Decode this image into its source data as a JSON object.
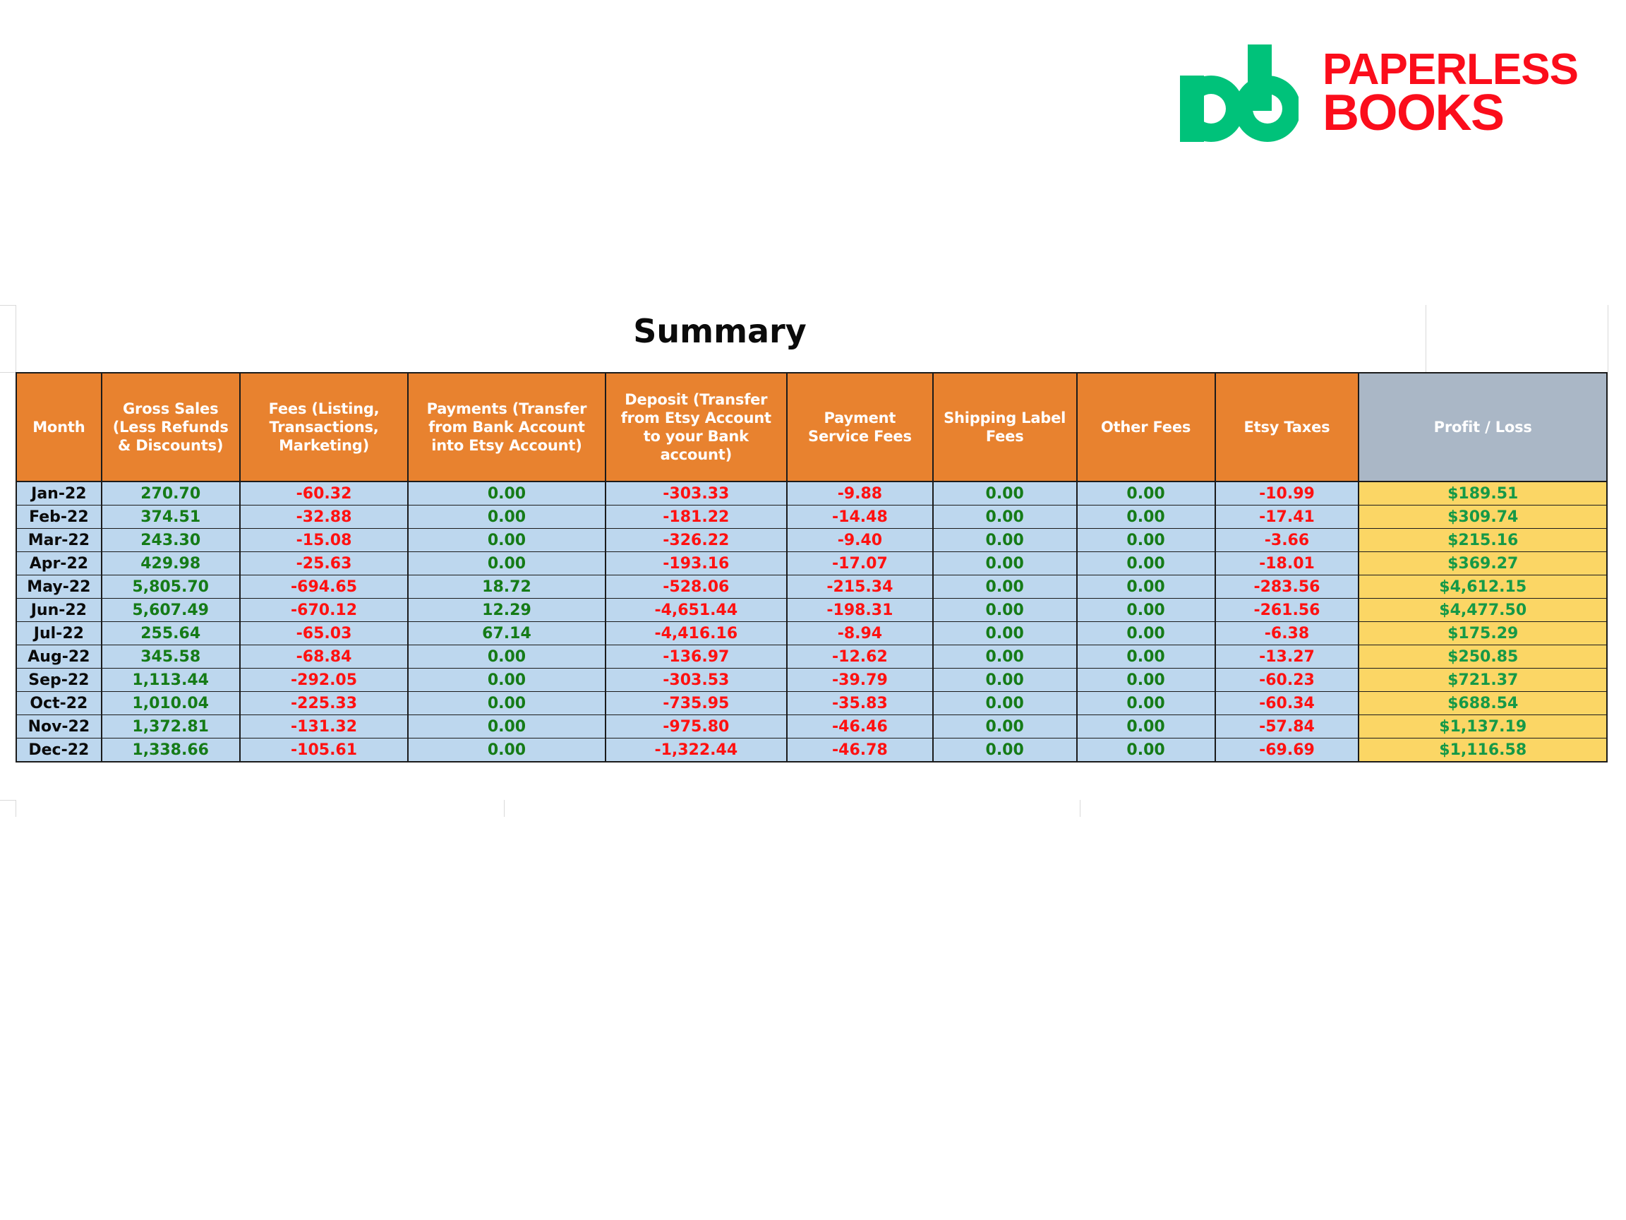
{
  "logo": {
    "mark_alt": "pb-monogram",
    "mark_color": "#00C27A",
    "word_line1": "PAPERLESS",
    "word_line2": "BOOKS",
    "word_color": "#FB0D1B"
  },
  "title": "Summary",
  "colors": {
    "header_orange": "#E8822F",
    "header_gray": "#AAB7C6",
    "row_blue": "#BDD7EE",
    "profit_yellow": "#FBD665",
    "positive_green": "#157B17",
    "negative_red": "#FF1111",
    "profit_green": "#159947"
  },
  "table": {
    "columns": [
      "Month",
      "Gross Sales (Less Refunds & Discounts)",
      "Fees (Listing, Transactions, Marketing)",
      "Payments (Transfer from Bank Account into Etsy Account)",
      "Deposit (Transfer from Etsy Account to your Bank account)",
      "Payment Service Fees",
      "Shipping Label Fees",
      "Other Fees",
      "Etsy Taxes",
      "Profit / Loss"
    ],
    "rows": [
      {
        "month": "Jan-22",
        "gross_sales": "270.70",
        "fees": "-60.32",
        "payments": "0.00",
        "deposit": "-303.33",
        "payment_service_fees": "-9.88",
        "shipping_label_fees": "0.00",
        "other_fees": "0.00",
        "etsy_taxes": "-10.99",
        "profit_loss": "$189.51"
      },
      {
        "month": "Feb-22",
        "gross_sales": "374.51",
        "fees": "-32.88",
        "payments": "0.00",
        "deposit": "-181.22",
        "payment_service_fees": "-14.48",
        "shipping_label_fees": "0.00",
        "other_fees": "0.00",
        "etsy_taxes": "-17.41",
        "profit_loss": "$309.74"
      },
      {
        "month": "Mar-22",
        "gross_sales": "243.30",
        "fees": "-15.08",
        "payments": "0.00",
        "deposit": "-326.22",
        "payment_service_fees": "-9.40",
        "shipping_label_fees": "0.00",
        "other_fees": "0.00",
        "etsy_taxes": "-3.66",
        "profit_loss": "$215.16"
      },
      {
        "month": "Apr-22",
        "gross_sales": "429.98",
        "fees": "-25.63",
        "payments": "0.00",
        "deposit": "-193.16",
        "payment_service_fees": "-17.07",
        "shipping_label_fees": "0.00",
        "other_fees": "0.00",
        "etsy_taxes": "-18.01",
        "profit_loss": "$369.27"
      },
      {
        "month": "May-22",
        "gross_sales": "5,805.70",
        "fees": "-694.65",
        "payments": "18.72",
        "deposit": "-528.06",
        "payment_service_fees": "-215.34",
        "shipping_label_fees": "0.00",
        "other_fees": "0.00",
        "etsy_taxes": "-283.56",
        "profit_loss": "$4,612.15"
      },
      {
        "month": "Jun-22",
        "gross_sales": "5,607.49",
        "fees": "-670.12",
        "payments": "12.29",
        "deposit": "-4,651.44",
        "payment_service_fees": "-198.31",
        "shipping_label_fees": "0.00",
        "other_fees": "0.00",
        "etsy_taxes": "-261.56",
        "profit_loss": "$4,477.50"
      },
      {
        "month": "Jul-22",
        "gross_sales": "255.64",
        "fees": "-65.03",
        "payments": "67.14",
        "deposit": "-4,416.16",
        "payment_service_fees": "-8.94",
        "shipping_label_fees": "0.00",
        "other_fees": "0.00",
        "etsy_taxes": "-6.38",
        "profit_loss": "$175.29"
      },
      {
        "month": "Aug-22",
        "gross_sales": "345.58",
        "fees": "-68.84",
        "payments": "0.00",
        "deposit": "-136.97",
        "payment_service_fees": "-12.62",
        "shipping_label_fees": "0.00",
        "other_fees": "0.00",
        "etsy_taxes": "-13.27",
        "profit_loss": "$250.85"
      },
      {
        "month": "Sep-22",
        "gross_sales": "1,113.44",
        "fees": "-292.05",
        "payments": "0.00",
        "deposit": "-303.53",
        "payment_service_fees": "-39.79",
        "shipping_label_fees": "0.00",
        "other_fees": "0.00",
        "etsy_taxes": "-60.23",
        "profit_loss": "$721.37"
      },
      {
        "month": "Oct-22",
        "gross_sales": "1,010.04",
        "fees": "-225.33",
        "payments": "0.00",
        "deposit": "-735.95",
        "payment_service_fees": "-35.83",
        "shipping_label_fees": "0.00",
        "other_fees": "0.00",
        "etsy_taxes": "-60.34",
        "profit_loss": "$688.54"
      },
      {
        "month": "Nov-22",
        "gross_sales": "1,372.81",
        "fees": "-131.32",
        "payments": "0.00",
        "deposit": "-975.80",
        "payment_service_fees": "-46.46",
        "shipping_label_fees": "0.00",
        "other_fees": "0.00",
        "etsy_taxes": "-57.84",
        "profit_loss": "$1,137.19"
      },
      {
        "month": "Dec-22",
        "gross_sales": "1,338.66",
        "fees": "-105.61",
        "payments": "0.00",
        "deposit": "-1,322.44",
        "payment_service_fees": "-46.78",
        "shipping_label_fees": "0.00",
        "other_fees": "0.00",
        "etsy_taxes": "-69.69",
        "profit_loss": "$1,116.58"
      }
    ]
  }
}
